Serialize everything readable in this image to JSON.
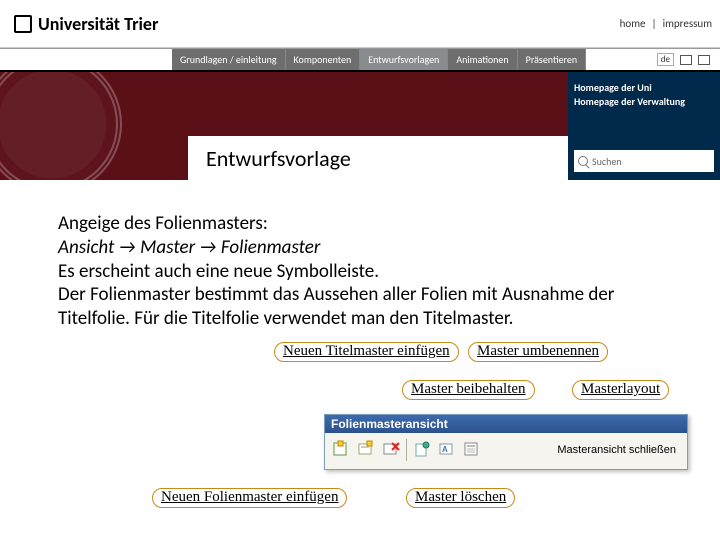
{
  "header": {
    "logo_text": "Universität Trier",
    "top_links": [
      "home",
      "impressum"
    ]
  },
  "nav": {
    "tabs": [
      {
        "label": "Grundlagen / einleitung"
      },
      {
        "label": "Komponenten"
      },
      {
        "label": "Entwurfsvorlagen",
        "active": true
      },
      {
        "label": "Animationen"
      },
      {
        "label": "Präsentieren"
      }
    ],
    "lang": "de"
  },
  "hero": {
    "title": "Entwurfsvorlage",
    "side_links": [
      "Homepage der Uni",
      "Homepage der Verwaltung"
    ],
    "search_placeholder": "Suchen"
  },
  "content": {
    "line1": "Angeige des Folienmasters:",
    "line2": "Ansicht → Master → Folienmaster",
    "line3": "Es erscheint auch eine neue Symbolleiste.",
    "line4": "Der Folienmaster bestimmt das Aussehen aller Folien mit Ausnahme der Titelfolie. Für die Titelfolie verwendet man den Titelmaster."
  },
  "buttons": {
    "insert_title_master": "Neuen Titelmaster einfügen",
    "rename_master": "Master umbenennen",
    "keep_master": "Master beibehalten",
    "master_layout": "Masterlayout",
    "insert_slide_master": "Neuen Folienmaster einfügen",
    "delete_master": "Master löschen"
  },
  "toolbar": {
    "title": "Folienmasteransicht",
    "close_label": "Masteransicht schließen",
    "icon_names": [
      "insert-slide-master-icon",
      "insert-title-master-icon",
      "delete-master-icon",
      "keep-master-icon",
      "rename-master-icon",
      "master-layout-icon"
    ]
  }
}
